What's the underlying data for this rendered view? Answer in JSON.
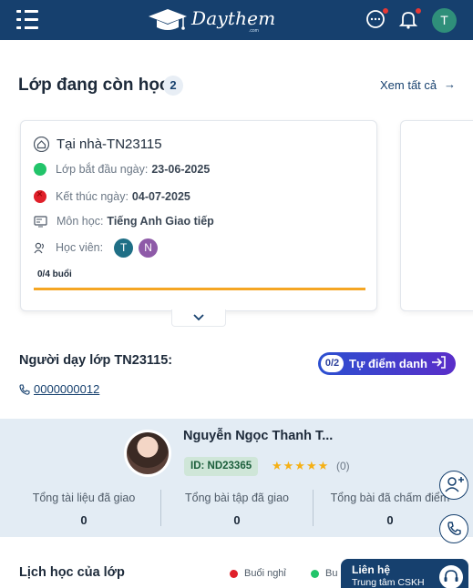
{
  "header": {
    "logo_text": "Daythem",
    "logo_sub": ".com",
    "avatar_letter": "T"
  },
  "classes": {
    "title": "Lớp đang còn học",
    "count": "2",
    "see_all": "Xem tất cả",
    "card": {
      "title": "Tại nhà-TN23115",
      "start_label": "Lớp bắt đầu ngày:",
      "start_value": "23-06-2025",
      "end_label": "Kết thúc ngày:",
      "end_value": "04-07-2025",
      "subject_label": "Môn học:",
      "subject_value": "Tiếng Anh Giao tiếp",
      "students_label": "Học viên:",
      "students": [
        "T",
        "N"
      ],
      "sessions": "0/4 buổi",
      "progress_fraction": 1.0
    }
  },
  "teacher": {
    "title": "Người dạy lớp TN23115:",
    "attend_count": "0/2",
    "attend_label": "Tự điểm danh",
    "phone": "0000000012",
    "name": "Nguyễn Ngọc Thanh T...",
    "id_label": "ID: ND23365",
    "rating_stars": 5,
    "reviews": "(0)",
    "stats": [
      {
        "label": "Tổng tài liệu đã giao",
        "value": "0"
      },
      {
        "label": "Tổng bài tập đã giao",
        "value": "0"
      },
      {
        "label": "Tổng bài đã chấm điểm",
        "value": "0"
      }
    ]
  },
  "support": {
    "line1": "Liên hệ",
    "line2": "Trung tâm CSKH"
  },
  "schedule": {
    "title": "Lịch học của lớp",
    "legend": [
      {
        "label": "Buổi nghỉ",
        "color": "#e0202a"
      },
      {
        "label": "Bu",
        "color": "#22c46a"
      }
    ]
  },
  "colors": {
    "primary": "#16406e",
    "progress": "#f5a623",
    "accent_gradient_start": "#2b4fd0",
    "accent_gradient_end": "#5a2ec9"
  }
}
